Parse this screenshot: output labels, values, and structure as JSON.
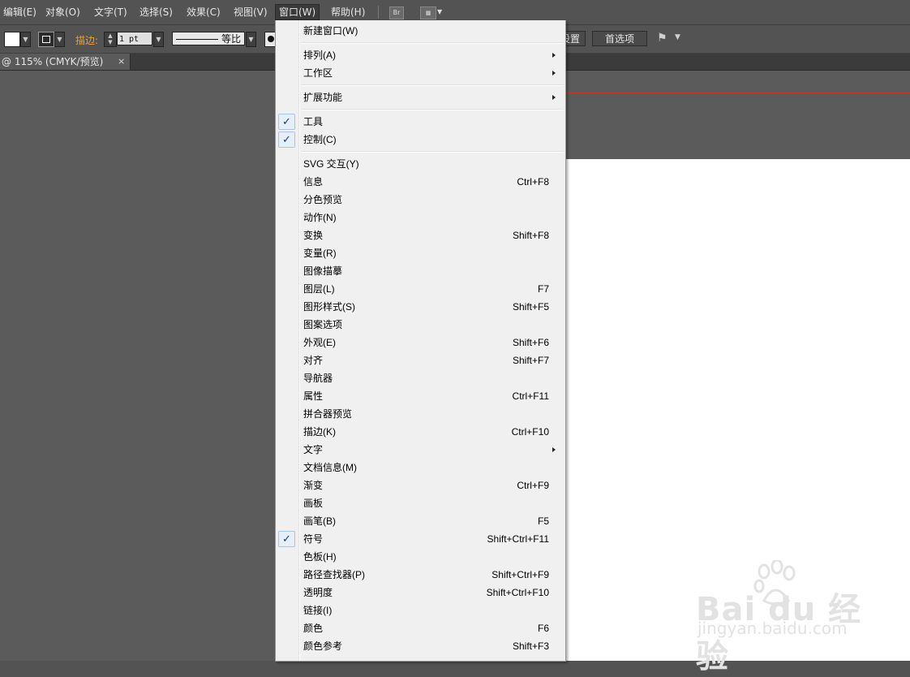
{
  "menubar": {
    "items": [
      "编辑(E)",
      "对象(O)",
      "文字(T)",
      "选择(S)",
      "效果(C)",
      "视图(V)",
      "窗口(W)",
      "帮助(H)"
    ],
    "active": "窗口(W)",
    "bridge_icon": "Br",
    "workspace_icon": "workspace-layout-icon"
  },
  "controlbar": {
    "stroke_label": "描边:",
    "stroke_weight": "1 pt",
    "profile_label": "等比",
    "settings_partial": "设置",
    "preferences_button": "首选项",
    "stroke_label_color": "#e8a230"
  },
  "tab": {
    "title": "@ 115% (CMYK/预览)",
    "close": "×"
  },
  "window_menu": {
    "items": [
      {
        "label": "新建窗口(W)",
        "shortcut": "",
        "submenu": false,
        "checked": false
      },
      {
        "label": "排列(A)",
        "shortcut": "",
        "submenu": true,
        "checked": false
      },
      {
        "label": "工作区",
        "shortcut": "",
        "submenu": true,
        "checked": false
      },
      {
        "label": "扩展功能",
        "shortcut": "",
        "submenu": true,
        "checked": false
      },
      {
        "label": "工具",
        "shortcut": "",
        "submenu": false,
        "checked": true
      },
      {
        "label": "控制(C)",
        "shortcut": "",
        "submenu": false,
        "checked": true
      },
      {
        "label": "SVG 交互(Y)",
        "shortcut": "",
        "submenu": false,
        "checked": false
      },
      {
        "label": "信息",
        "shortcut": "Ctrl+F8",
        "submenu": false,
        "checked": false
      },
      {
        "label": "分色预览",
        "shortcut": "",
        "submenu": false,
        "checked": false
      },
      {
        "label": "动作(N)",
        "shortcut": "",
        "submenu": false,
        "checked": false
      },
      {
        "label": "变换",
        "shortcut": "Shift+F8",
        "submenu": false,
        "checked": false
      },
      {
        "label": "变量(R)",
        "shortcut": "",
        "submenu": false,
        "checked": false
      },
      {
        "label": "图像描摹",
        "shortcut": "",
        "submenu": false,
        "checked": false
      },
      {
        "label": "图层(L)",
        "shortcut": "F7",
        "submenu": false,
        "checked": false
      },
      {
        "label": "图形样式(S)",
        "shortcut": "Shift+F5",
        "submenu": false,
        "checked": false
      },
      {
        "label": "图案选项",
        "shortcut": "",
        "submenu": false,
        "checked": false
      },
      {
        "label": "外观(E)",
        "shortcut": "Shift+F6",
        "submenu": false,
        "checked": false
      },
      {
        "label": "对齐",
        "shortcut": "Shift+F7",
        "submenu": false,
        "checked": false
      },
      {
        "label": "导航器",
        "shortcut": "",
        "submenu": false,
        "checked": false
      },
      {
        "label": "属性",
        "shortcut": "Ctrl+F11",
        "submenu": false,
        "checked": false
      },
      {
        "label": "拼合器预览",
        "shortcut": "",
        "submenu": false,
        "checked": false
      },
      {
        "label": "描边(K)",
        "shortcut": "Ctrl+F10",
        "submenu": false,
        "checked": false
      },
      {
        "label": "文字",
        "shortcut": "",
        "submenu": true,
        "checked": false
      },
      {
        "label": "文档信息(M)",
        "shortcut": "",
        "submenu": false,
        "checked": false
      },
      {
        "label": "渐变",
        "shortcut": "Ctrl+F9",
        "submenu": false,
        "checked": false
      },
      {
        "label": "画板",
        "shortcut": "",
        "submenu": false,
        "checked": false
      },
      {
        "label": "画笔(B)",
        "shortcut": "F5",
        "submenu": false,
        "checked": false
      },
      {
        "label": "符号",
        "shortcut": "Shift+Ctrl+F11",
        "submenu": false,
        "checked": true
      },
      {
        "label": "色板(H)",
        "shortcut": "",
        "submenu": false,
        "checked": false
      },
      {
        "label": "路径查找器(P)",
        "shortcut": "Shift+Ctrl+F9",
        "submenu": false,
        "checked": false
      },
      {
        "label": "透明度",
        "shortcut": "Shift+Ctrl+F10",
        "submenu": false,
        "checked": false
      },
      {
        "label": "链接(I)",
        "shortcut": "",
        "submenu": false,
        "checked": false
      },
      {
        "label": "颜色",
        "shortcut": "F6",
        "submenu": false,
        "checked": false
      },
      {
        "label": "颜色参考",
        "shortcut": "Shift+F3",
        "submenu": false,
        "checked": false
      }
    ],
    "check_glyph": "✓"
  },
  "watermark": {
    "logo": "Bai du 经验",
    "url": "jingyan.baidu.com"
  }
}
